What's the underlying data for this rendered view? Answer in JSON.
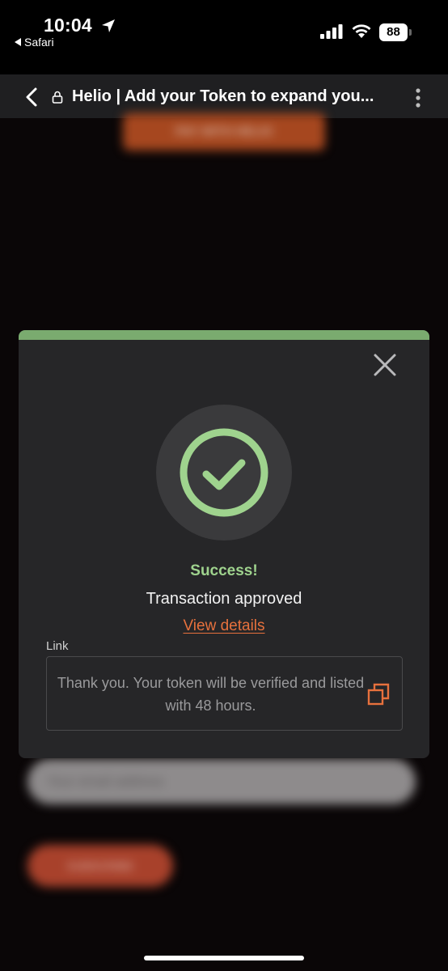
{
  "status_bar": {
    "time": "10:04",
    "back_app": "Safari",
    "battery": "88"
  },
  "browser": {
    "title": "Helio | Add your Token to expand you..."
  },
  "background": {
    "pay_button": "PAY WITH HELIO",
    "email_placeholder": "Your email address",
    "subscribe_button": "SUBSCRIBE"
  },
  "modal": {
    "accent_color": "#7aab6f",
    "status_title": "Success!",
    "status_subtitle": "Transaction approved",
    "view_details_link": "View details",
    "link_label": "Link",
    "link_value": "Thank you. Your token will be verified and listed with 48 hours.",
    "icons": [
      "close-icon",
      "checkmark-icon",
      "copy-icon"
    ]
  }
}
